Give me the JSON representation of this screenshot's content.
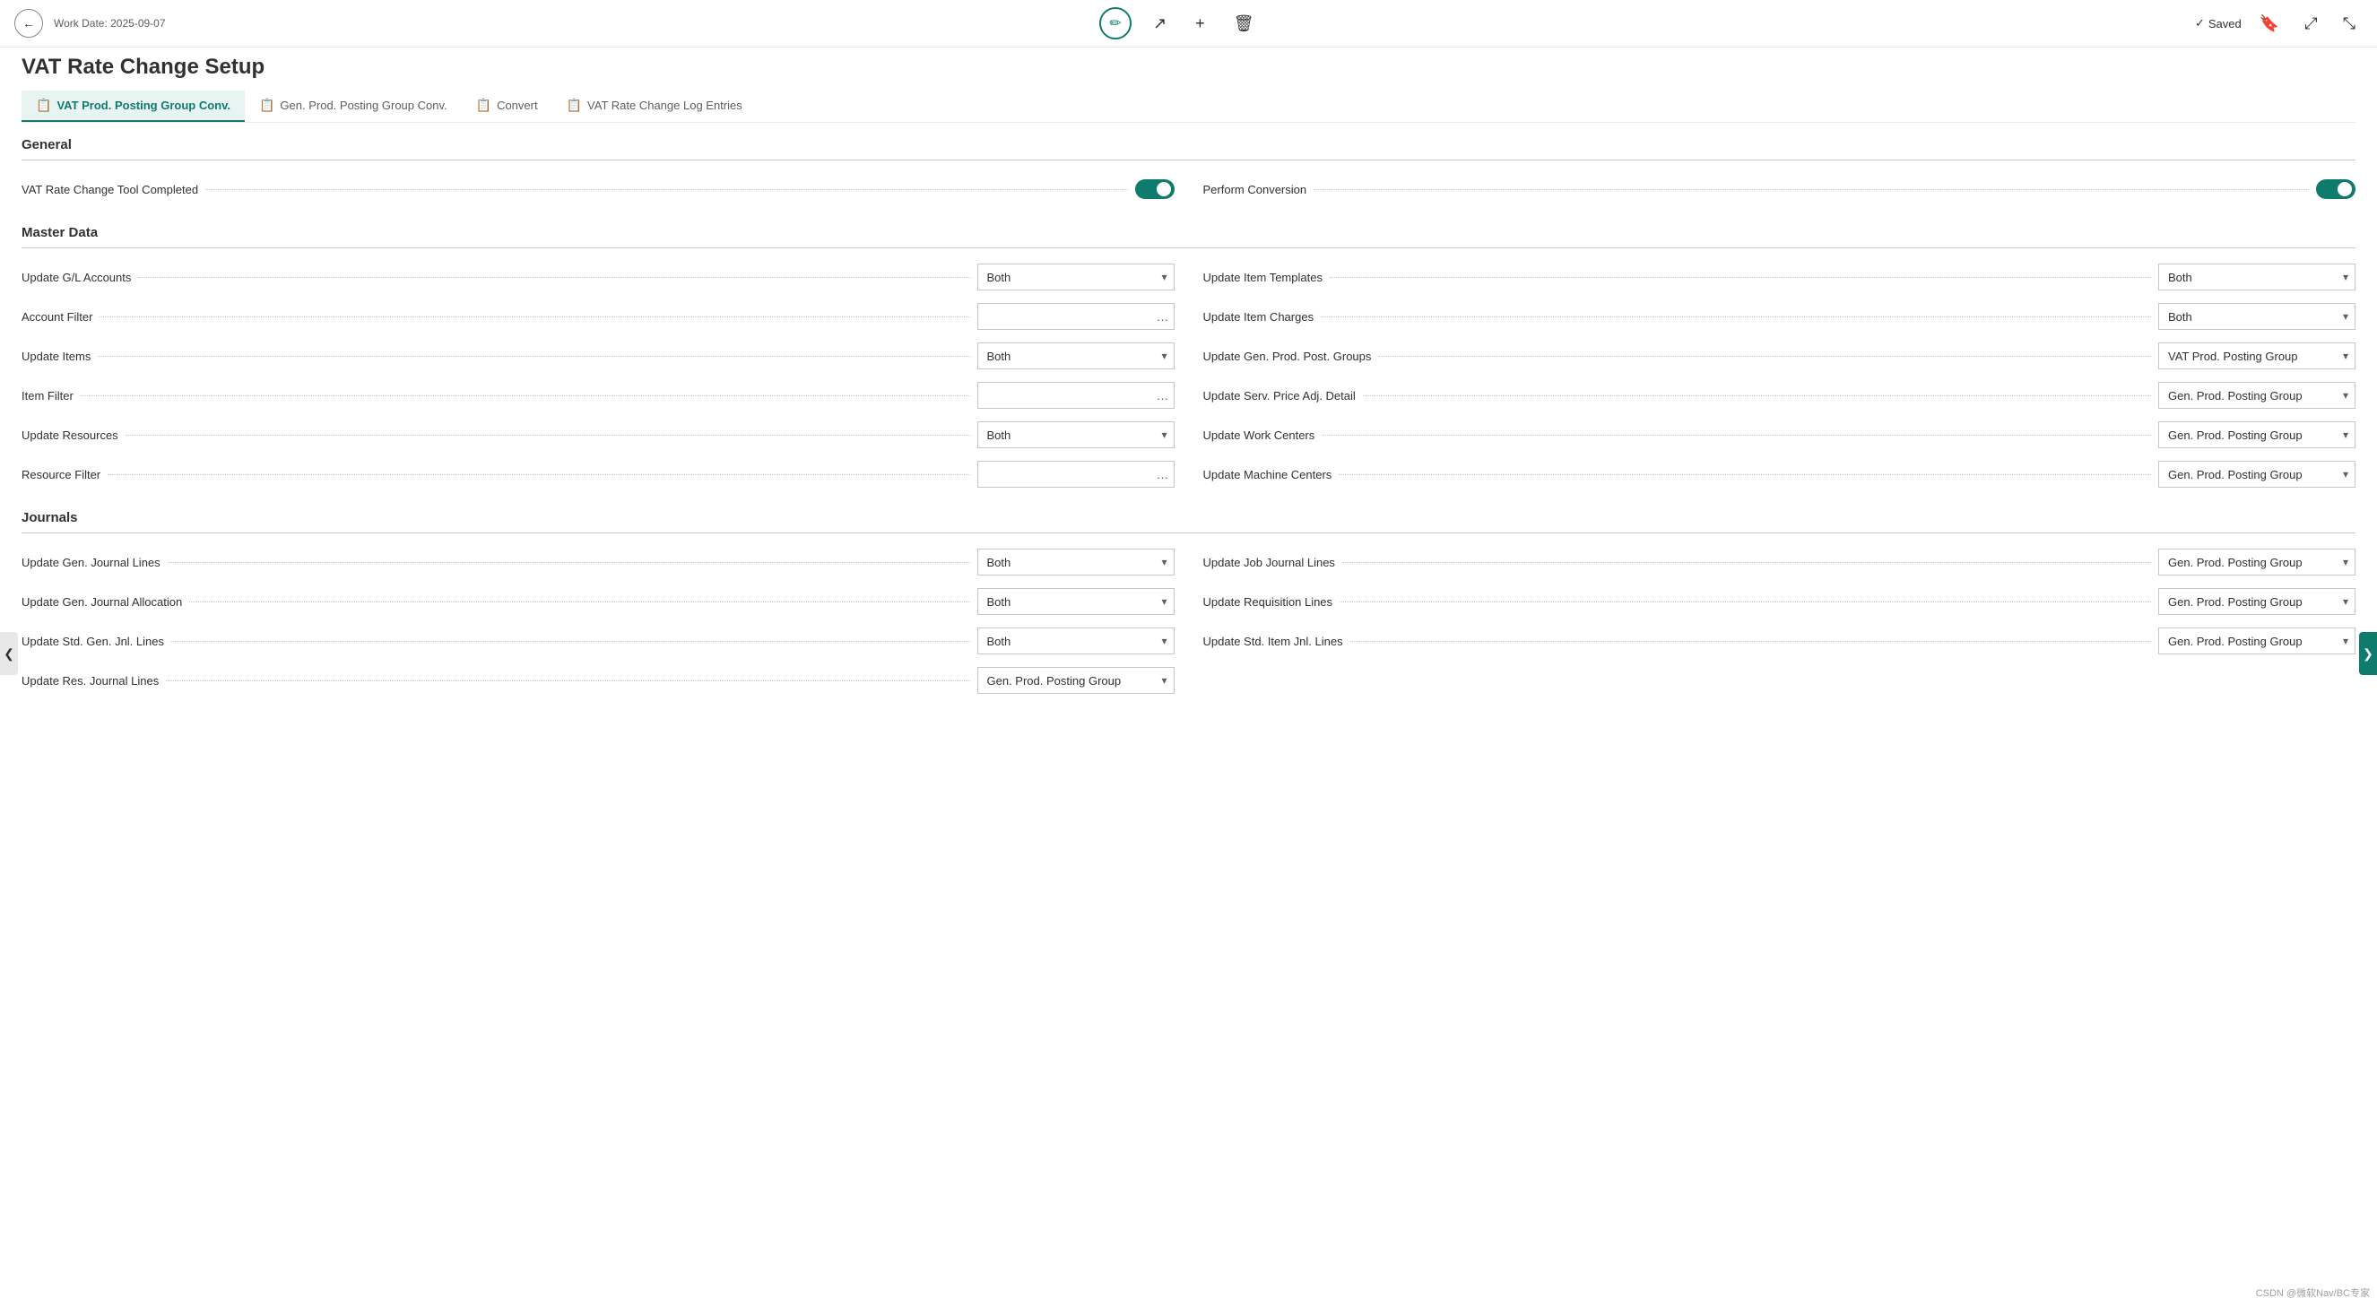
{
  "workDate": "Work Date: 2025-09-07",
  "pageTitle": "VAT Rate Change Setup",
  "savedLabel": "Saved",
  "tabs": [
    {
      "id": "vat-prod",
      "label": "VAT Prod. Posting Group Conv.",
      "icon": "📋",
      "active": true
    },
    {
      "id": "gen-prod",
      "label": "Gen. Prod. Posting Group Conv.",
      "icon": "📋",
      "active": false
    },
    {
      "id": "convert",
      "label": "Convert",
      "icon": "📋",
      "active": false
    },
    {
      "id": "log-entries",
      "label": "VAT Rate Change Log Entries",
      "icon": "📋",
      "active": false
    }
  ],
  "general": {
    "title": "General",
    "vatRateChangeToolCompleted": {
      "label": "VAT Rate Change Tool Completed",
      "value": true
    },
    "performConversion": {
      "label": "Perform Conversion",
      "value": true
    }
  },
  "masterData": {
    "title": "Master Data",
    "fields": [
      {
        "left": {
          "label": "Update G/L Accounts",
          "type": "select",
          "value": "Both",
          "options": [
            "Both",
            "VAT Prod. Posting Group",
            "Gen. Prod. Posting Group"
          ]
        },
        "right": {
          "label": "Update Item Templates",
          "type": "select",
          "value": "Both",
          "options": [
            "Both",
            "VAT Prod. Posting Group",
            "Gen. Prod. Posting Group"
          ]
        }
      },
      {
        "left": {
          "label": "Account Filter",
          "type": "input-dots",
          "value": ""
        },
        "right": {
          "label": "Update Item Charges",
          "type": "select",
          "value": "Both",
          "options": [
            "Both",
            "VAT Prod. Posting Group",
            "Gen. Prod. Posting Group"
          ]
        }
      },
      {
        "left": {
          "label": "Update Items",
          "type": "select",
          "value": "Both",
          "options": [
            "Both",
            "VAT Prod. Posting Group",
            "Gen. Prod. Posting Group"
          ]
        },
        "right": {
          "label": "Update Gen. Prod. Post. Groups",
          "type": "select",
          "value": "VAT Prod. Posting Group",
          "options": [
            "Both",
            "VAT Prod. Posting Group",
            "Gen. Prod. Posting Group"
          ]
        }
      },
      {
        "left": {
          "label": "Item Filter",
          "type": "input-dots",
          "value": ""
        },
        "right": {
          "label": "Update Serv. Price Adj. Detail",
          "type": "select",
          "value": "Gen. Prod. Posting Group",
          "options": [
            "Both",
            "VAT Prod. Posting Group",
            "Gen. Prod. Posting Group"
          ]
        }
      },
      {
        "left": {
          "label": "Update Resources",
          "type": "select",
          "value": "Both",
          "options": [
            "Both",
            "VAT Prod. Posting Group",
            "Gen. Prod. Posting Group"
          ]
        },
        "right": {
          "label": "Update Work Centers",
          "type": "select",
          "value": "Gen. Prod. Posting Group",
          "options": [
            "Both",
            "VAT Prod. Posting Group",
            "Gen. Prod. Posting Group"
          ]
        }
      },
      {
        "left": {
          "label": "Resource Filter",
          "type": "input-dots",
          "value": ""
        },
        "right": {
          "label": "Update Machine Centers",
          "type": "select",
          "value": "Gen. Prod. Posting Group",
          "options": [
            "Both",
            "VAT Prod. Posting Group",
            "Gen. Prod. Posting Group"
          ]
        }
      }
    ]
  },
  "journals": {
    "title": "Journals",
    "fields": [
      {
        "left": {
          "label": "Update Gen. Journal Lines",
          "type": "select",
          "value": "Both",
          "options": [
            "Both",
            "VAT Prod. Posting Group",
            "Gen. Prod. Posting Group"
          ]
        },
        "right": {
          "label": "Update Job Journal Lines",
          "type": "select",
          "value": "Gen. Prod. Posting Group",
          "options": [
            "Both",
            "VAT Prod. Posting Group",
            "Gen. Prod. Posting Group"
          ]
        }
      },
      {
        "left": {
          "label": "Update Gen. Journal Allocation",
          "type": "select",
          "value": "Both",
          "options": [
            "Both",
            "VAT Prod. Posting Group",
            "Gen. Prod. Posting Group"
          ]
        },
        "right": {
          "label": "Update Requisition Lines",
          "type": "select",
          "value": "Gen. Prod. Posting Group",
          "options": [
            "Both",
            "VAT Prod. Posting Group",
            "Gen. Prod. Posting Group"
          ]
        }
      },
      {
        "left": {
          "label": "Update Std. Gen. Jnl. Lines",
          "type": "select",
          "value": "Both",
          "options": [
            "Both",
            "VAT Prod. Posting Group",
            "Gen. Prod. Posting Group"
          ]
        },
        "right": {
          "label": "Update Std. Item Jnl. Lines",
          "type": "select",
          "value": "Gen. Prod. Posting Group",
          "options": [
            "Both",
            "VAT Prod. Posting Group",
            "Gen. Prod. Posting Group"
          ]
        }
      },
      {
        "left": {
          "label": "Update Res. Journal Lines",
          "type": "select",
          "value": "Gen. Prod. Posting Group",
          "options": [
            "Both",
            "VAT Prod. Posting Group",
            "Gen. Prod. Posting Group"
          ]
        },
        "right": null
      }
    ]
  },
  "icons": {
    "back": "←",
    "edit": "✏",
    "share": "↗",
    "add": "+",
    "delete": "🗑",
    "saved_check": "✓",
    "bookmark": "🔖",
    "expand": "⤢",
    "maximize": "⤡",
    "chevron_down": "▾",
    "dots": "…",
    "left_arrow": "❮",
    "right_arrow": "❯"
  }
}
